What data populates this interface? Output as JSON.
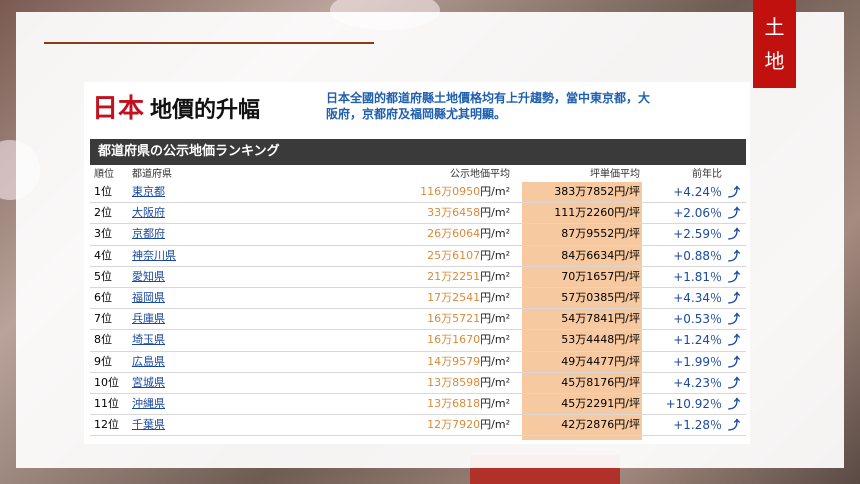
{
  "tab": {
    "line1": "土",
    "line2": "地"
  },
  "title": {
    "part1": "日本",
    "part2": "地價的升幅"
  },
  "description": "日本全國的都道府縣土地價格均有上升趨勢，當中東京都，大阪府，京都府及福岡縣尤其明顯。",
  "ranking_title": "都道府県の公示地価ランキング",
  "columns": {
    "rank": "順位",
    "prefecture": "都道府県",
    "price": "公示地価平均",
    "tsubo": "坪単価平均",
    "change": "前年比"
  },
  "rows": [
    {
      "rank": "1位",
      "prefecture": "東京都",
      "price": "116万0950",
      "price_unit": "円/m²",
      "tsubo": "383万7852円/坪",
      "change": "+4.24％"
    },
    {
      "rank": "2位",
      "prefecture": "大阪府",
      "price": "33万6458",
      "price_unit": "円/m²",
      "tsubo": "111万2260円/坪",
      "change": "+2.06％"
    },
    {
      "rank": "3位",
      "prefecture": "京都府",
      "price": "26万6064",
      "price_unit": "円/m²",
      "tsubo": "87万9552円/坪",
      "change": "+2.59％"
    },
    {
      "rank": "4位",
      "prefecture": "神奈川県",
      "price": "25万6107",
      "price_unit": "円/m²",
      "tsubo": "84万6634円/坪",
      "change": "+0.88％"
    },
    {
      "rank": "5位",
      "prefecture": "愛知県",
      "price": "21万2251",
      "price_unit": "円/m²",
      "tsubo": "70万1657円/坪",
      "change": "+1.81％"
    },
    {
      "rank": "6位",
      "prefecture": "福岡県",
      "price": "17万2541",
      "price_unit": "円/m²",
      "tsubo": "57万0385円/坪",
      "change": "+4.34％"
    },
    {
      "rank": "7位",
      "prefecture": "兵庫県",
      "price": "16万5721",
      "price_unit": "円/m²",
      "tsubo": "54万7841円/坪",
      "change": "+0.53％"
    },
    {
      "rank": "8位",
      "prefecture": "埼玉県",
      "price": "16万1670",
      "price_unit": "円/m²",
      "tsubo": "53万4448円/坪",
      "change": "+1.24％"
    },
    {
      "rank": "9位",
      "prefecture": "広島県",
      "price": "14万9579",
      "price_unit": "円/m²",
      "tsubo": "49万4477円/坪",
      "change": "+1.99％"
    },
    {
      "rank": "10位",
      "prefecture": "宮城県",
      "price": "13万8598",
      "price_unit": "円/m²",
      "tsubo": "45万8176円/坪",
      "change": "+4.23％"
    },
    {
      "rank": "11位",
      "prefecture": "沖縄県",
      "price": "13万6818",
      "price_unit": "円/m²",
      "tsubo": "45万2291円/坪",
      "change": "+10.92％"
    },
    {
      "rank": "12位",
      "prefecture": "千葉県",
      "price": "12万7920",
      "price_unit": "円/m²",
      "tsubo": "42万2876円/坪",
      "change": "+1.28％"
    }
  ],
  "icons": {
    "trend": "upward-trend-arrow-icon"
  },
  "colors": {
    "tab": "#c0110f",
    "title_red": "#c1121f",
    "desc_blue": "#1f5fb0",
    "price_orange": "#d98a3a",
    "tsubo_column": "#f7c9a0"
  }
}
